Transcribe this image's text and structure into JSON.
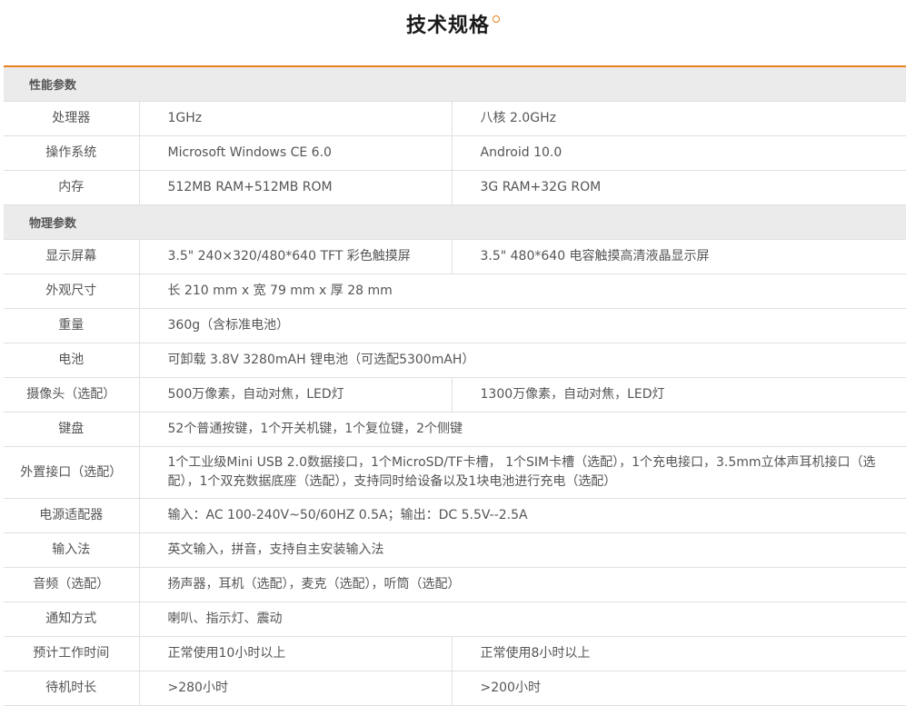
{
  "page": {
    "title": "技术规格",
    "accent_color": "#e8821f"
  },
  "sections": [
    {
      "name": "性能参数",
      "rows": [
        {
          "label": "处理器",
          "values": [
            "1GHz",
            "八核 2.0GHz"
          ]
        },
        {
          "label": "操作系统",
          "values": [
            "Microsoft Windows CE 6.0",
            "Android 10.0"
          ]
        },
        {
          "label": "内存",
          "values": [
            "512MB RAM+512MB ROM",
            "3G RAM+32G ROM"
          ]
        }
      ]
    },
    {
      "name": "物理参数",
      "rows": [
        {
          "label": "显示屏幕",
          "values": [
            "3.5\" 240×320/480*640 TFT 彩色触摸屏",
            "3.5\" 480*640 电容触摸高清液晶显示屏"
          ]
        },
        {
          "label": "外观尺寸",
          "values": [
            "长 210 mm x 宽 79 mm x 厚 28 mm"
          ]
        },
        {
          "label": "重量",
          "values": [
            "360g（含标准电池）"
          ]
        },
        {
          "label": "电池",
          "values": [
            "可卸载 3.8V 3280mAH 锂电池（可选配5300mAH）"
          ]
        },
        {
          "label": "摄像头（选配）",
          "values": [
            "500万像素，自动对焦，LED灯",
            "1300万像素，自动对焦，LED灯"
          ]
        },
        {
          "label": "键盘",
          "values": [
            "52个普通按键，1个开关机键，1个复位键，2个侧键"
          ]
        },
        {
          "label": "外置接口（选配）",
          "values": [
            "1个工业级Mini USB 2.0数据接口，1个MicroSD/TF卡槽， 1个SIM卡槽（选配），1个充电接口，3.5mm立体声耳机接口（选配），1个双充数据底座（选配），支持同时给设备以及1块电池进行充电（选配）"
          ]
        },
        {
          "label": "电源适配器",
          "values": [
            "输入：AC 100-240V~50/60HZ 0.5A；输出：DC 5.5V--2.5A"
          ]
        },
        {
          "label": "输入法",
          "values": [
            "英文输入，拼音，支持自主安装输入法"
          ]
        },
        {
          "label": "音频（选配）",
          "values": [
            "扬声器，耳机（选配），麦克（选配），听筒（选配）"
          ]
        },
        {
          "label": "通知方式",
          "values": [
            "喇叭、指示灯、震动"
          ]
        },
        {
          "label": "预计工作时间",
          "values": [
            "正常使用10小时以上",
            "正常使用8小时以上"
          ]
        },
        {
          "label": "待机时长",
          "values": [
            ">280小时",
            ">200小时"
          ]
        }
      ]
    }
  ]
}
